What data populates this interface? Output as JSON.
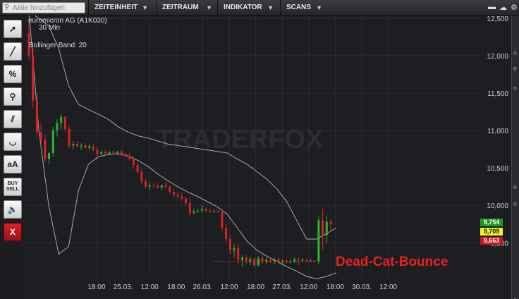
{
  "search": {
    "placeholder": "Aktie hinzufügen"
  },
  "menu": [
    {
      "label": "ZEITEINHEIT"
    },
    {
      "label": "ZEITRAUM"
    },
    {
      "label": "INDIKATOR"
    },
    {
      "label": "SCANS"
    }
  ],
  "toolbar": {
    "tools": [
      "cursor-tool",
      "line-tool",
      "percent-tool",
      "zoom-tool",
      "parallel-lines-tool",
      "arc-tool",
      "text-tool",
      "buy-sell-tool",
      "sound-tool",
      "close-tool"
    ],
    "text_label": "aA",
    "buy_label": "BUY",
    "sell_label": "SELL",
    "percent_label": "%",
    "close_label": "X"
  },
  "chart_info": {
    "instrument": "euromicron AG (A1K030)",
    "interval": "30 Min",
    "indicator": "Bollinger Band: 20",
    "watermark": "TRADERFOX"
  },
  "price_tags": [
    {
      "value": "9,754",
      "bg": "#1c9a1c",
      "fg": "#ffffff"
    },
    {
      "value": "9,709",
      "bg": "#f2f229",
      "fg": "#111111"
    },
    {
      "value": "9,663",
      "bg": "#c4161c",
      "fg": "#ffffff"
    }
  ],
  "annotation": {
    "text": "Dead-Cat-Bounce",
    "color": "#e8231f"
  },
  "colors": {
    "up": "#2db52d",
    "down": "#d8222b",
    "band": "#a9a9a9",
    "grid": "#2c2d30"
  },
  "chart_data": {
    "type": "candlestick",
    "y_ticks": [
      "12,500",
      "12,000",
      "11,500",
      "11,000",
      "10,500",
      "10,000",
      "9,500"
    ],
    "ylim": [
      9.05,
      12.5
    ],
    "x_ticks": [
      "18:00",
      "25.03.",
      "12:00",
      "18:00",
      "26.03.",
      "12:00",
      "18:00",
      "27.03.",
      "12:00",
      "18:00",
      "30.03.",
      "12:00"
    ],
    "candles": [
      [
        12.3,
        12.45,
        11.95,
        12.0
      ],
      [
        12.0,
        12.1,
        11.3,
        11.4
      ],
      [
        11.4,
        11.5,
        10.9,
        10.98
      ],
      [
        10.98,
        11.1,
        10.8,
        10.88
      ],
      [
        10.88,
        10.95,
        10.58,
        10.62
      ],
      [
        10.62,
        10.72,
        10.55,
        10.7
      ],
      [
        10.7,
        11.05,
        10.65,
        11.0
      ],
      [
        11.0,
        11.15,
        10.92,
        11.1
      ],
      [
        11.1,
        11.22,
        11.02,
        11.18
      ],
      [
        11.18,
        11.2,
        10.98,
        11.02
      ],
      [
        11.02,
        11.06,
        10.76,
        10.8
      ],
      [
        10.8,
        10.86,
        10.75,
        10.82
      ],
      [
        10.82,
        10.86,
        10.77,
        10.79
      ],
      [
        10.79,
        10.83,
        10.74,
        10.8
      ],
      [
        10.8,
        10.84,
        10.76,
        10.77
      ],
      [
        10.77,
        10.82,
        10.74,
        10.79
      ],
      [
        10.79,
        10.83,
        10.72,
        10.74
      ],
      [
        10.74,
        10.77,
        10.66,
        10.69
      ],
      [
        10.69,
        10.73,
        10.66,
        10.71
      ],
      [
        10.71,
        10.74,
        10.67,
        10.69
      ],
      [
        10.69,
        10.73,
        10.67,
        10.71
      ],
      [
        10.71,
        10.74,
        10.68,
        10.7
      ],
      [
        10.7,
        10.73,
        10.67,
        10.72
      ],
      [
        10.72,
        10.74,
        10.66,
        10.68
      ],
      [
        10.68,
        10.71,
        10.64,
        10.66
      ],
      [
        10.66,
        10.7,
        10.6,
        10.62
      ],
      [
        10.62,
        10.65,
        10.5,
        10.54
      ],
      [
        10.54,
        10.57,
        10.42,
        10.45
      ],
      [
        10.45,
        10.48,
        10.28,
        10.32
      ],
      [
        10.32,
        10.36,
        10.22,
        10.25
      ],
      [
        10.25,
        10.3,
        10.2,
        10.27
      ],
      [
        10.27,
        10.3,
        10.24,
        10.26
      ],
      [
        10.26,
        10.29,
        10.22,
        10.24
      ],
      [
        10.24,
        10.28,
        10.2,
        10.27
      ],
      [
        10.27,
        10.31,
        10.23,
        10.25
      ],
      [
        10.25,
        10.27,
        10.16,
        10.18
      ],
      [
        10.18,
        10.22,
        10.1,
        10.14
      ],
      [
        10.14,
        10.18,
        10.08,
        10.12
      ],
      [
        10.12,
        10.16,
        10.06,
        10.09
      ],
      [
        10.09,
        10.12,
        10.0,
        10.03
      ],
      [
        10.03,
        10.1,
        9.85,
        9.9
      ],
      [
        9.9,
        9.95,
        9.88,
        9.92
      ],
      [
        9.92,
        9.95,
        9.9,
        9.93
      ],
      [
        9.93,
        10.0,
        9.9,
        9.95
      ],
      [
        9.95,
        9.97,
        9.91,
        9.93
      ],
      [
        9.93,
        9.95,
        9.9,
        9.92
      ],
      [
        9.92,
        9.94,
        9.9,
        9.92
      ],
      [
        9.92,
        9.94,
        9.9,
        9.91
      ],
      [
        9.91,
        9.95,
        9.65,
        9.7
      ],
      [
        9.7,
        9.75,
        9.5,
        9.55
      ],
      [
        9.55,
        9.6,
        9.35,
        9.4
      ],
      [
        9.4,
        9.48,
        9.3,
        9.43
      ],
      [
        9.43,
        9.47,
        9.22,
        9.27
      ],
      [
        9.27,
        9.33,
        9.18,
        9.3
      ],
      [
        9.3,
        9.34,
        9.22,
        9.25
      ],
      [
        9.25,
        9.31,
        9.2,
        9.28
      ],
      [
        9.28,
        9.3,
        9.17,
        9.2
      ],
      [
        9.2,
        9.32,
        9.18,
        9.29
      ],
      [
        9.29,
        9.33,
        9.22,
        9.25
      ],
      [
        9.25,
        9.3,
        9.21,
        9.27
      ],
      [
        9.27,
        9.31,
        9.23,
        9.25
      ],
      [
        9.25,
        9.3,
        9.21,
        9.28
      ],
      [
        9.28,
        9.3,
        9.22,
        9.24
      ],
      [
        9.24,
        9.28,
        9.2,
        9.26
      ],
      [
        9.26,
        9.28,
        9.22,
        9.24
      ],
      [
        9.24,
        9.27,
        9.22,
        9.25
      ],
      [
        9.25,
        9.3,
        9.23,
        9.28
      ],
      [
        9.28,
        9.3,
        9.2,
        9.27
      ],
      [
        9.27,
        9.29,
        9.24,
        9.27
      ],
      [
        9.27,
        9.28,
        9.24,
        9.26
      ],
      [
        9.26,
        9.28,
        9.24,
        9.26
      ],
      [
        9.26,
        9.27,
        9.24,
        9.25
      ],
      [
        9.25,
        9.85,
        9.22,
        9.8
      ],
      [
        9.8,
        9.95,
        9.4,
        9.6
      ],
      [
        9.6,
        9.85,
        9.5,
        9.78
      ],
      [
        9.78,
        9.82,
        9.65,
        9.75
      ]
    ],
    "upper_band": [
      12.6,
      12.5,
      12.4,
      12.1,
      11.6,
      11.35,
      11.28,
      11.22,
      11.15,
      11.05,
      10.98,
      10.93,
      10.9,
      10.86,
      10.82,
      10.8,
      10.78,
      10.76,
      10.74,
      10.72,
      10.7,
      10.62,
      10.55,
      10.45,
      10.35,
      10.22,
      10.05,
      9.8,
      9.55,
      9.55,
      9.62,
      9.7
    ],
    "lower_band": [
      12.6,
      11.0,
      10.0,
      9.35,
      9.45,
      10.2,
      10.55,
      10.65,
      10.68,
      10.69,
      10.66,
      10.6,
      10.52,
      10.42,
      10.33,
      10.25,
      10.18,
      10.12,
      10.05,
      9.98,
      9.88,
      9.7,
      9.52,
      9.4,
      9.32,
      9.25,
      9.18,
      9.12,
      9.05,
      9.02,
      9.05,
      9.1
    ],
    "gap_line": 9.25
  }
}
